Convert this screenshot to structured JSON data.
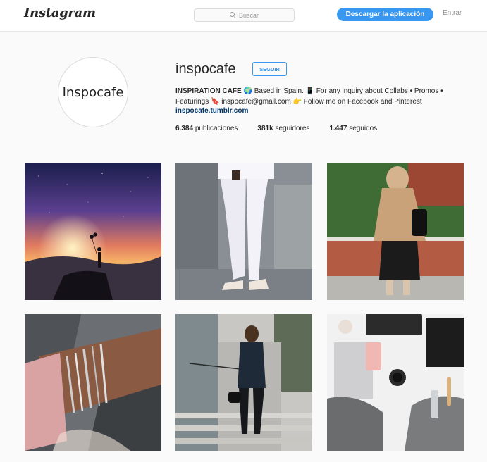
{
  "header": {
    "logo_text": "Instagram",
    "search_placeholder": "Buscar",
    "download_label": "Descargar la aplicación",
    "login_label": "Entrar"
  },
  "profile": {
    "avatar_text": "Inspocafe",
    "username": "inspocafe",
    "follow_label": "SEGUIR",
    "bio_name": "INSPIRATION CAFE",
    "bio_text": "🌍 Based in Spain. 📱 For any inquiry about Collabs • Promos • Featurings 🔖 inspocafe@gmail.com 👉 Follow me on Facebook and Pinterest",
    "link": "inspocafe.tumblr.com",
    "stats": {
      "posts_count": "6.384",
      "posts_label": "publicaciones",
      "followers_count": "381k",
      "followers_label": "seguidores",
      "following_count": "1.447",
      "following_label": "seguidos"
    }
  },
  "posts": [
    {
      "subject": "galaxy-sunset-silhouette-photo"
    },
    {
      "subject": "white-jeans-heels-photo"
    },
    {
      "subject": "beige-sweater-street-photo"
    },
    {
      "subject": "bracelets-wrist-photo"
    },
    {
      "subject": "blazer-stairs-outfit-photo"
    },
    {
      "subject": "desk-flatlay-photo"
    }
  ],
  "colors": {
    "accent": "#3897f0",
    "link": "#003569",
    "background": "#fafafa"
  }
}
